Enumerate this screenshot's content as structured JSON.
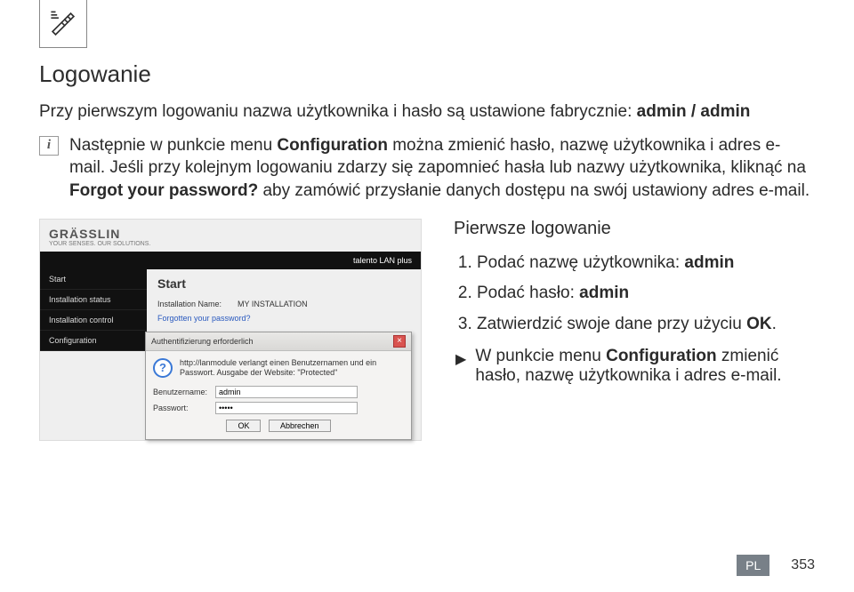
{
  "corner_icon": "hand-icon",
  "title": "Logowanie",
  "intro_prefix": "Przy pierwszym logowaniu nazwa użytkownika i hasło są ustawione fabrycznie: ",
  "intro_bold": "admin / admin",
  "info_line1_a": "Następnie w punkcie menu ",
  "info_line1_b": "Configuration",
  "info_line1_c": " można zmienić hasło, nazwę użytkownika i adres e-mail. Jeśli przy kolejnym logowaniu zdarzy się zapomnieć hasła lub nazwy użytkownika, kliknąć na ",
  "info_line1_d": "Forgot your password?",
  "info_line1_e": " aby zamówić przysłanie danych dostępu na swój ustawiony adres e-mail.",
  "screenshot": {
    "brand": "GRÄSSLIN",
    "brand_tag": "YOUR SENSES. OUR SOLUTIONS.",
    "product": "talento LAN plus",
    "sidebar": [
      "Start",
      "Installation status",
      "Installation control",
      "Configuration"
    ],
    "panel_title": "Start",
    "inst_label": "Installation Name:",
    "inst_value": "MY INSTALLATION",
    "forgot_link": "Forgotten your password?",
    "dialog_title": "Authentifizierung erforderlich",
    "dialog_msg": "http://lanmodule verlangt einen Benutzernamen und ein Passwort. Ausgabe der Website: \"Protected\"",
    "user_label": "Benutzername:",
    "user_value": "admin",
    "pass_label": "Passwort:",
    "pass_value": "•••••",
    "ok": "OK",
    "cancel": "Abbrechen"
  },
  "right": {
    "heading": "Pierwsze logowanie",
    "step1_a": "Podać nazwę użytkownika: ",
    "step1_b": "admin",
    "step2_a": "Podać hasło: ",
    "step2_b": "admin",
    "step3_a": "Zatwierdzić swoje dane przy użyciu ",
    "step3_b": "OK",
    "step3_c": ".",
    "note_a": "W punkcie menu ",
    "note_b": "Configuration",
    "note_c": " zmienić hasło, nazwę użytkownika i adres e-mail."
  },
  "footer": {
    "badge": "PL",
    "page": "353"
  }
}
